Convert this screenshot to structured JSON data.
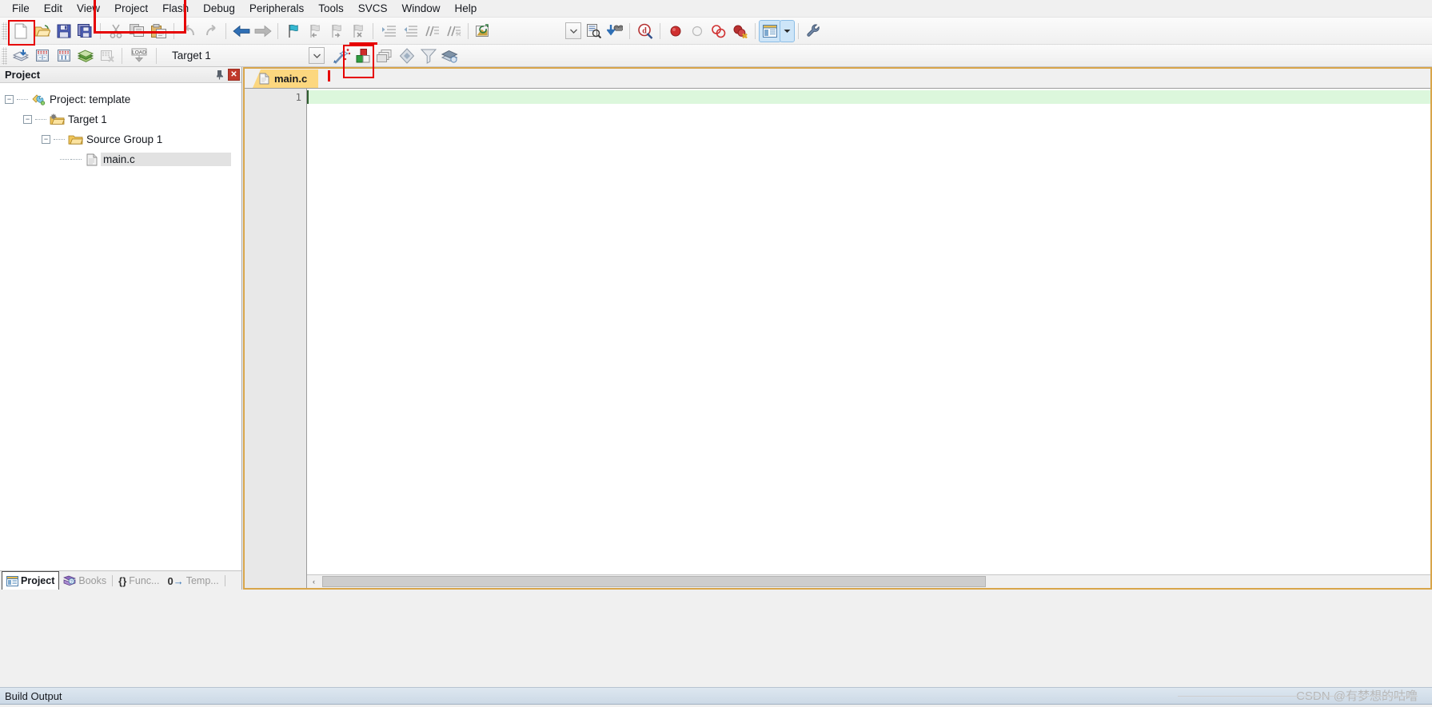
{
  "app": {
    "title": "Keil uVision IDE",
    "accent_orange": "#d8a54a",
    "accent_red": "#e60000",
    "tab_yellow": "#fcd77f",
    "active_line_green": "#dcf7dc"
  },
  "menubar": {
    "items": [
      {
        "label": "File",
        "name": "menu-file"
      },
      {
        "label": "Edit",
        "name": "menu-edit"
      },
      {
        "label": "View",
        "name": "menu-view"
      },
      {
        "label": "Project",
        "name": "menu-project"
      },
      {
        "label": "Flash",
        "name": "menu-flash"
      },
      {
        "label": "Debug",
        "name": "menu-debug"
      },
      {
        "label": "Peripherals",
        "name": "menu-peripherals"
      },
      {
        "label": "Tools",
        "name": "menu-tools"
      },
      {
        "label": "SVCS",
        "name": "menu-svcs"
      },
      {
        "label": "Window",
        "name": "menu-window"
      },
      {
        "label": "Help",
        "name": "menu-help"
      }
    ]
  },
  "toolbar_main": {
    "buttons": [
      {
        "name": "new-file-icon",
        "title": "New"
      },
      {
        "name": "open-file-icon",
        "title": "Open"
      },
      {
        "name": "save-icon",
        "title": "Save"
      },
      {
        "name": "save-all-icon",
        "title": "Save All"
      },
      {
        "name": "cut-icon",
        "title": "Cut"
      },
      {
        "name": "copy-icon",
        "title": "Copy"
      },
      {
        "name": "paste-icon",
        "title": "Paste"
      },
      {
        "name": "undo-icon",
        "title": "Undo"
      },
      {
        "name": "redo-icon",
        "title": "Redo"
      },
      {
        "name": "navigate-back-icon",
        "title": "Back"
      },
      {
        "name": "navigate-forward-icon",
        "title": "Forward"
      },
      {
        "name": "bookmark-toggle-icon",
        "title": "Insert/Remove Bookmark"
      },
      {
        "name": "bookmark-prev-icon",
        "title": "Previous Bookmark"
      },
      {
        "name": "bookmark-next-icon",
        "title": "Next Bookmark"
      },
      {
        "name": "bookmark-clear-icon",
        "title": "Clear All Bookmarks"
      },
      {
        "name": "indent-icon",
        "title": "Indent"
      },
      {
        "name": "outdent-icon",
        "title": "Outdent"
      },
      {
        "name": "comment-icon",
        "title": "Comment"
      },
      {
        "name": "uncomment-icon",
        "title": "Uncomment"
      },
      {
        "name": "open-editor-icon",
        "title": "Open Editor"
      },
      {
        "name": "find-combo-dropdown-icon",
        "title": "Find box dropdown"
      },
      {
        "name": "find-in-files-icon",
        "title": "Find in Files"
      },
      {
        "name": "binocular-icon",
        "title": "Incremental Find"
      },
      {
        "name": "debug-session-icon",
        "title": "Start/Stop Debug Session"
      },
      {
        "name": "insert-breakpoint-icon",
        "title": "Insert/Remove Breakpoint"
      },
      {
        "name": "enable-breakpoint-icon",
        "title": "Enable/Disable Breakpoint"
      },
      {
        "name": "disable-all-breakpoints-icon",
        "title": "Disable All Breakpoints"
      },
      {
        "name": "kill-all-breakpoints-icon",
        "title": "Kill All Breakpoints"
      },
      {
        "name": "window-layout-icon",
        "title": "Window Layout"
      },
      {
        "name": "window-layout-dropdown-icon",
        "title": "Window Layout dropdown"
      },
      {
        "name": "configure-icon",
        "title": "Configure"
      }
    ]
  },
  "toolbar_build": {
    "buttons": [
      {
        "name": "translate-icon",
        "title": "Translate"
      },
      {
        "name": "build-icon",
        "title": "Build"
      },
      {
        "name": "rebuild-icon",
        "title": "Rebuild"
      },
      {
        "name": "batch-build-icon",
        "title": "Batch Build"
      },
      {
        "name": "stop-build-icon",
        "title": "Stop Build"
      },
      {
        "name": "download-icon",
        "title": "Download"
      }
    ],
    "target_value": "Target 1",
    "target_placeholder": "Target 1",
    "after_buttons": [
      {
        "name": "target-options-wand-icon",
        "title": "Options for Target"
      },
      {
        "name": "manage-project-items-icon",
        "title": "Manage Project Items"
      },
      {
        "name": "manage-multi-project-icon",
        "title": "Manage Multi-Project Workspace"
      },
      {
        "name": "components-icon",
        "title": "Components"
      },
      {
        "name": "pack-installer-icon",
        "title": "Pack Installer"
      },
      {
        "name": "manage-run-time-icon",
        "title": "Manage Run-Time Environment"
      }
    ]
  },
  "project_panel": {
    "title": "Project",
    "pin_icon": "pin-icon",
    "close_icon": "close-icon",
    "tree": [
      {
        "label": "Project: template",
        "icon": "project-icon",
        "indent": 0,
        "expanded": true,
        "selected": false,
        "name": "tree-item-project"
      },
      {
        "label": "Target 1",
        "icon": "target-icon",
        "indent": 1,
        "expanded": true,
        "selected": false,
        "name": "tree-item-target"
      },
      {
        "label": "Source Group 1",
        "icon": "folder-icon",
        "indent": 2,
        "expanded": true,
        "selected": false,
        "name": "tree-item-source-group"
      },
      {
        "label": "main.c",
        "icon": "c-file-icon",
        "indent": 3,
        "expanded": null,
        "selected": true,
        "name": "tree-item-main-c"
      }
    ],
    "tabs": [
      {
        "label": "Project",
        "icon": "project-window-icon",
        "active": true,
        "name": "panel-tab-project"
      },
      {
        "label": "Books",
        "icon": "books-icon",
        "active": false,
        "name": "panel-tab-books"
      },
      {
        "label": "Func...",
        "icon": "functions-icon",
        "active": false,
        "name": "panel-tab-functions"
      },
      {
        "label": "Temp...",
        "icon": "templates-icon",
        "active": false,
        "name": "panel-tab-templates"
      }
    ]
  },
  "editor": {
    "tabs": [
      {
        "label": "main.c",
        "icon": "c-file-icon",
        "active": true,
        "name": "editor-tab-main-c"
      }
    ],
    "line_numbers": [
      "1"
    ],
    "lines": [
      ""
    ],
    "scrollbar_left_arrow": "‹"
  },
  "build_output": {
    "title": "Build Output"
  },
  "watermark": {
    "text": "CSDN @有梦想的咕噜"
  }
}
